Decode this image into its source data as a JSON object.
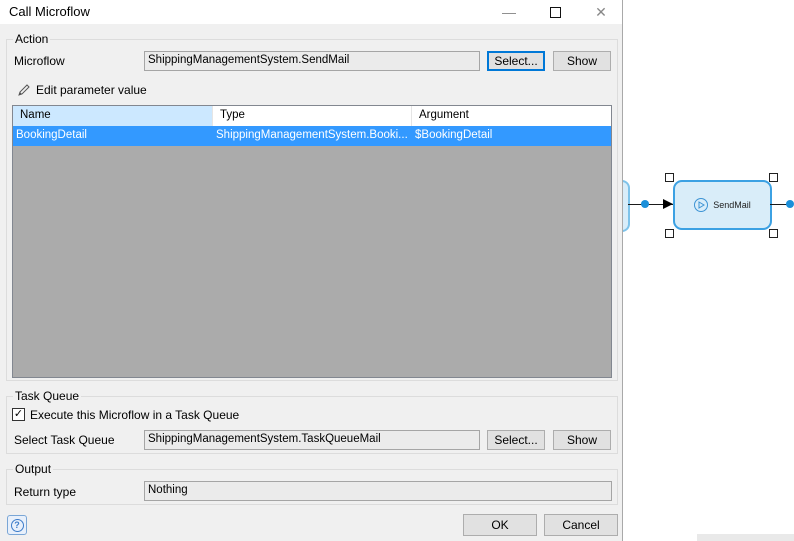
{
  "dialog": {
    "title": "Call Microflow",
    "minimize_glyph": "—",
    "close_glyph": "✕"
  },
  "action": {
    "group_title": "Action",
    "microflow_label": "Microflow",
    "microflow_value": "ShippingManagementSystem.SendMail",
    "select_label": "Select...",
    "show_label": "Show",
    "edit_param_label": "Edit parameter value"
  },
  "parameters": {
    "columns": [
      "Name",
      "Type",
      "Argument"
    ],
    "rows": [
      {
        "name": "BookingDetail",
        "type": "ShippingManagementSystem.Booki...",
        "argument": "$BookingDetail"
      }
    ]
  },
  "task_queue": {
    "group_title": "Task Queue",
    "checkbox_label": "Execute this Microflow in a Task Queue",
    "checked": true,
    "check_glyph": "✓",
    "select_label_text": "Select Task Queue",
    "queue_value": "ShippingManagementSystem.TaskQueueMail",
    "select_label": "Select...",
    "show_label": "Show"
  },
  "output": {
    "group_title": "Output",
    "return_type_label": "Return type",
    "return_type_value": "Nothing"
  },
  "footer": {
    "help_glyph": "?",
    "ok_label": "OK",
    "cancel_label": "Cancel"
  },
  "canvas": {
    "activity_label": "SendMail",
    "activity_icon": "play-circle-icon"
  },
  "colors": {
    "selection": "#3399ff",
    "header_selected": "#cce8ff",
    "activity_border": "#3ca1e3",
    "activity_fill": "#d9edf9",
    "flow_dot": "#1b8fd9"
  }
}
